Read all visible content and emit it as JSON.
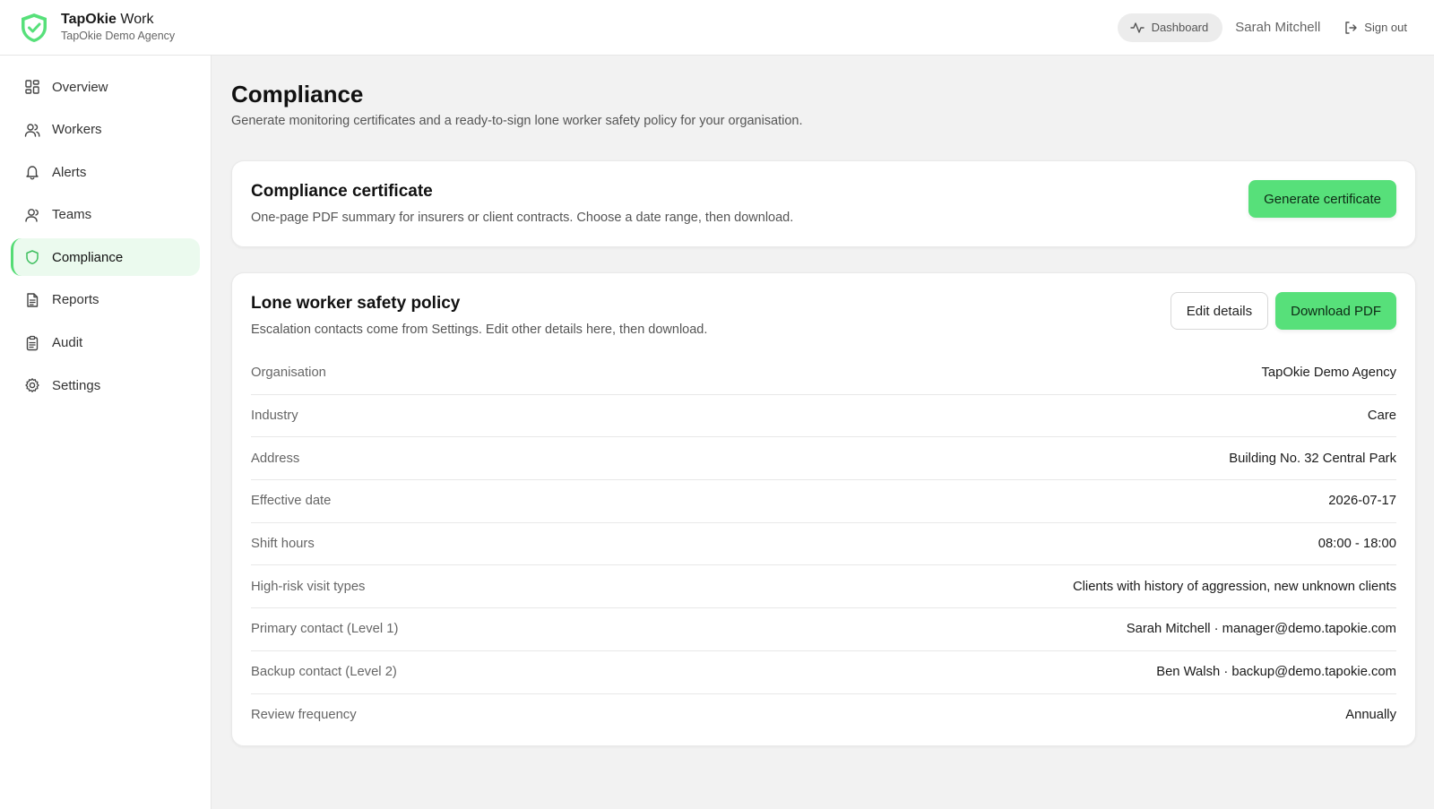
{
  "brand": {
    "app_name_bold": "TapOkie",
    "app_name_rest": " Work",
    "org_name": "TapOkie Demo Agency",
    "logo_icon": "shield-check-icon",
    "accent_color": "#57e07a"
  },
  "header": {
    "dashboard_label": "Dashboard",
    "user_name": "Sarah Mitchell",
    "signout_label": "Sign out"
  },
  "sidebar": {
    "items": [
      {
        "label": "Overview",
        "icon": "grid-icon"
      },
      {
        "label": "Workers",
        "icon": "users-icon"
      },
      {
        "label": "Alerts",
        "icon": "bell-icon"
      },
      {
        "label": "Teams",
        "icon": "team-icon"
      },
      {
        "label": "Compliance",
        "icon": "shield-icon",
        "active": true
      },
      {
        "label": "Reports",
        "icon": "file-icon"
      },
      {
        "label": "Audit",
        "icon": "clipboard-icon"
      },
      {
        "label": "Settings",
        "icon": "gear-icon"
      }
    ]
  },
  "page": {
    "title": "Compliance",
    "subtitle": "Generate monitoring certificates and a ready-to-sign lone worker safety policy for your organisation."
  },
  "certificate": {
    "title": "Compliance certificate",
    "description": "One-page PDF summary for insurers or client contracts. Choose a date range, then download.",
    "button_label": "Generate certificate"
  },
  "policy": {
    "title": "Lone worker safety policy",
    "description": "Escalation contacts come from Settings. Edit other details here, then download.",
    "edit_label": "Edit details",
    "download_label": "Download PDF",
    "rows": [
      {
        "label": "Organisation",
        "value": "TapOkie Demo Agency"
      },
      {
        "label": "Industry",
        "value": "Care"
      },
      {
        "label": "Address",
        "value": "Building No. 32 Central Park"
      },
      {
        "label": "Effective date",
        "value": "2026-07-17"
      },
      {
        "label": "Shift hours",
        "value": "08:00 - 18:00"
      },
      {
        "label": "High-risk visit types",
        "value": "Clients with history of aggression, new unknown clients"
      },
      {
        "label": "Primary contact (Level 1)",
        "value": "Sarah Mitchell · manager@demo.tapokie.com"
      },
      {
        "label": "Backup contact (Level 2)",
        "value": "Ben Walsh · backup@demo.tapokie.com"
      },
      {
        "label": "Review frequency",
        "value": "Annually"
      }
    ]
  }
}
